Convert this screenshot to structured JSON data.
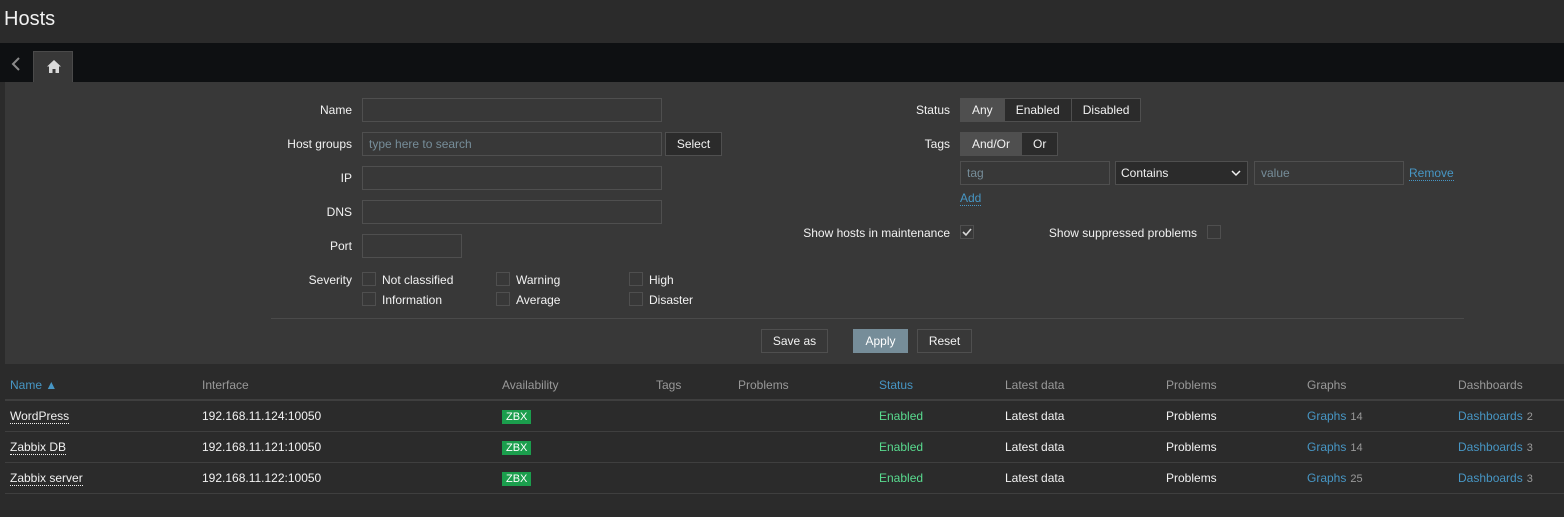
{
  "page": {
    "title": "Hosts"
  },
  "filter": {
    "name": {
      "label": "Name",
      "value": ""
    },
    "host_groups": {
      "label": "Host groups",
      "placeholder": "type here to search",
      "select_label": "Select"
    },
    "ip": {
      "label": "IP",
      "value": ""
    },
    "dns": {
      "label": "DNS",
      "value": ""
    },
    "port": {
      "label": "Port",
      "value": ""
    },
    "severity": {
      "label": "Severity",
      "options": [
        "Not classified",
        "Warning",
        "High",
        "Information",
        "Average",
        "Disaster"
      ]
    },
    "status": {
      "label": "Status",
      "options": [
        "Any",
        "Enabled",
        "Disabled"
      ],
      "selected": "Any"
    },
    "tags": {
      "label": "Tags",
      "options": [
        "And/Or",
        "Or"
      ],
      "selected": "And/Or",
      "tag_placeholder": "tag",
      "operator": "Contains",
      "value_placeholder": "value",
      "remove_label": "Remove",
      "add_label": "Add"
    },
    "show_maintenance": {
      "label": "Show hosts in maintenance",
      "checked": true
    },
    "show_suppressed": {
      "label": "Show suppressed problems",
      "checked": false
    },
    "buttons": {
      "save_as": "Save as",
      "apply": "Apply",
      "reset": "Reset"
    }
  },
  "table": {
    "columns": [
      "Name ▲",
      "Interface",
      "Availability",
      "Tags",
      "Problems",
      "Status",
      "Latest data",
      "Problems",
      "Graphs",
      "Dashboards"
    ],
    "rows": [
      {
        "name": "WordPress",
        "interface": "192.168.11.124:10050",
        "availability": "ZBX",
        "status": "Enabled",
        "latest": "Latest data",
        "problems": "Problems",
        "graphs": "Graphs",
        "graphs_count": "14",
        "dashboards": "Dashboards",
        "dashboards_count": "2"
      },
      {
        "name": "Zabbix DB",
        "interface": "192.168.11.121:10050",
        "availability": "ZBX",
        "status": "Enabled",
        "latest": "Latest data",
        "problems": "Problems",
        "graphs": "Graphs",
        "graphs_count": "14",
        "dashboards": "Dashboards",
        "dashboards_count": "3"
      },
      {
        "name": "Zabbix server",
        "interface": "192.168.11.122:10050",
        "availability": "ZBX",
        "status": "Enabled",
        "latest": "Latest data",
        "problems": "Problems",
        "graphs": "Graphs",
        "graphs_count": "25",
        "dashboards": "Dashboards",
        "dashboards_count": "3"
      }
    ]
  },
  "colors": {
    "accent": "#4796c4",
    "enabled": "#59db8f",
    "zbx": "#1b9e4d",
    "apply_button": "#768d99"
  }
}
